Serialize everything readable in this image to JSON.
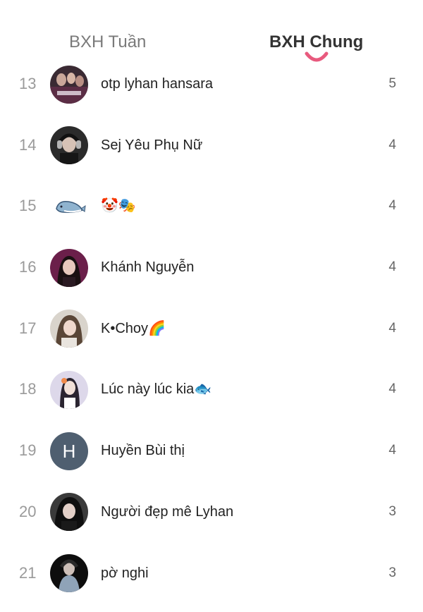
{
  "tabs": {
    "week": "BXH Tuần",
    "all": "BXH Chung",
    "active": "all",
    "accent_color": "#e85a7e"
  },
  "rows": [
    {
      "rank": "13",
      "name": "otp lyhan hansara",
      "score": "5",
      "avatar": "photo-group-icon"
    },
    {
      "rank": "14",
      "name": "Sej Yêu Phụ Nữ",
      "score": "4",
      "avatar": "photo-headphones-icon"
    },
    {
      "rank": "15",
      "name": "🤡🎭",
      "score": "4",
      "avatar": "cartoon-whale-icon"
    },
    {
      "rank": "16",
      "name": "Khánh Nguyễn",
      "score": "4",
      "avatar": "photo-portrait-pink-icon"
    },
    {
      "rank": "17",
      "name": "K•Choy🌈",
      "score": "4",
      "avatar": "photo-portrait-light-icon"
    },
    {
      "rank": "18",
      "name": "Lúc này lúc kia🐟",
      "score": "4",
      "avatar": "photo-portrait-lavender-icon"
    },
    {
      "rank": "19",
      "name": "Huyền Bùi thị",
      "score": "4",
      "avatar": "letter-avatar-icon",
      "initial": "H"
    },
    {
      "rank": "20",
      "name": "Người đẹp mê Lyhan",
      "score": "3",
      "avatar": "photo-portrait-dark-icon"
    },
    {
      "rank": "21",
      "name": "pờ nghi",
      "score": "3",
      "avatar": "photo-portrait-black-icon"
    }
  ]
}
